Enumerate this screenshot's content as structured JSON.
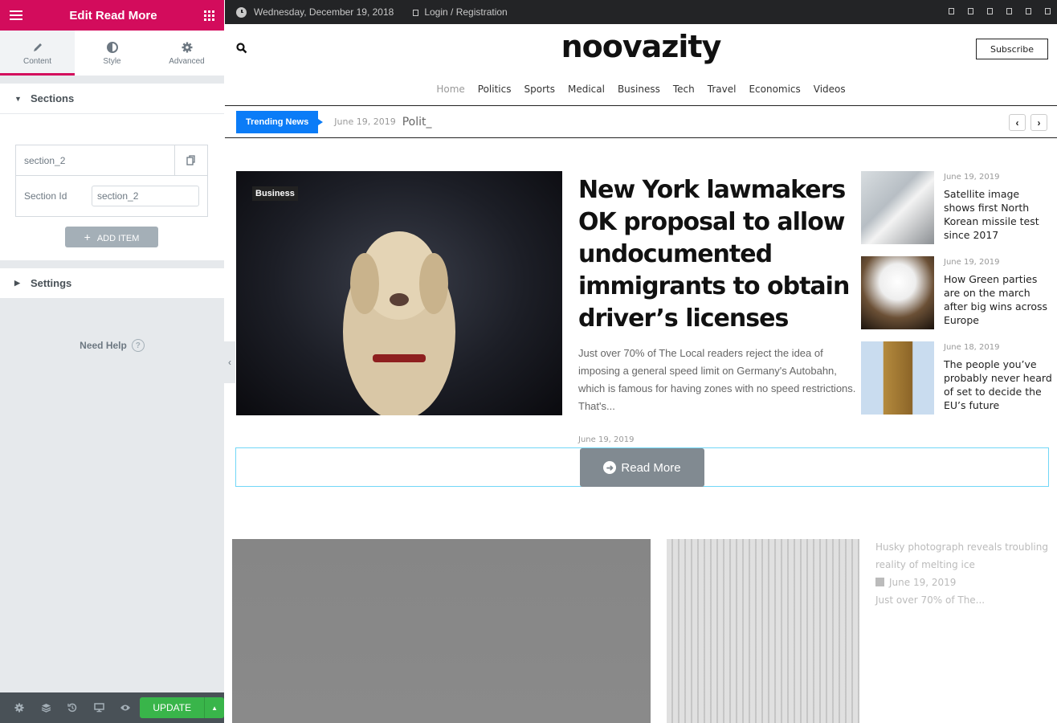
{
  "panel": {
    "title": "Edit Read More",
    "tabs": [
      {
        "label": "Content",
        "icon": "pencil-icon",
        "active": true
      },
      {
        "label": "Style",
        "icon": "contrast-icon",
        "active": false
      },
      {
        "label": "Advanced",
        "icon": "gear-icon",
        "active": false
      }
    ],
    "sections_label": "Sections",
    "repeater": {
      "item_title": "section_2",
      "field_label": "Section Id",
      "field_value": "section_2"
    },
    "add_item_label": "ADD ITEM",
    "settings_label": "Settings",
    "help_label": "Need Help",
    "footer": {
      "update_label": "UPDATE"
    },
    "accent_color": "#d30c5c",
    "update_color": "#39b54a"
  },
  "site": {
    "topbar": {
      "date": "Wednesday, December 19, 2018",
      "login": "Login / Registration"
    },
    "logo": "noovazity",
    "subscribe_label": "Subscribe",
    "nav": [
      "Home",
      "Politics",
      "Sports",
      "Medical",
      "Business",
      "Tech",
      "Travel",
      "Economics",
      "Videos"
    ],
    "ticker": {
      "label": "Trending News",
      "date": "June 19, 2019",
      "title": "Polit_"
    },
    "hero": {
      "category": "Business",
      "title": "New York lawmakers OK proposal to allow undocumented immigrants to obtain driver’s licenses",
      "excerpt": "Just over 70% of The Local readers reject the idea of imposing a general speed limit on Germany's Autobahn, which is famous for having zones with no speed restrictions. That's...",
      "date": "June 19, 2019"
    },
    "read_more_label": "Read More",
    "side_posts": [
      {
        "date": "June 19, 2019",
        "title": "Satellite image shows first North Korean missile test since 2017"
      },
      {
        "date": "June 19, 2019",
        "title": "How Green parties are on the march after big wins across Europe"
      },
      {
        "date": "June 18, 2019",
        "title": "The people you’ve probably never heard of set to decide the EU’s future"
      }
    ],
    "bottom_post": {
      "title": "Husky photograph reveals troubling reality of melting ice",
      "date": "June 19, 2019",
      "excerpt": "Just over 70% of The..."
    },
    "trending_color": "#0b7cf7"
  }
}
